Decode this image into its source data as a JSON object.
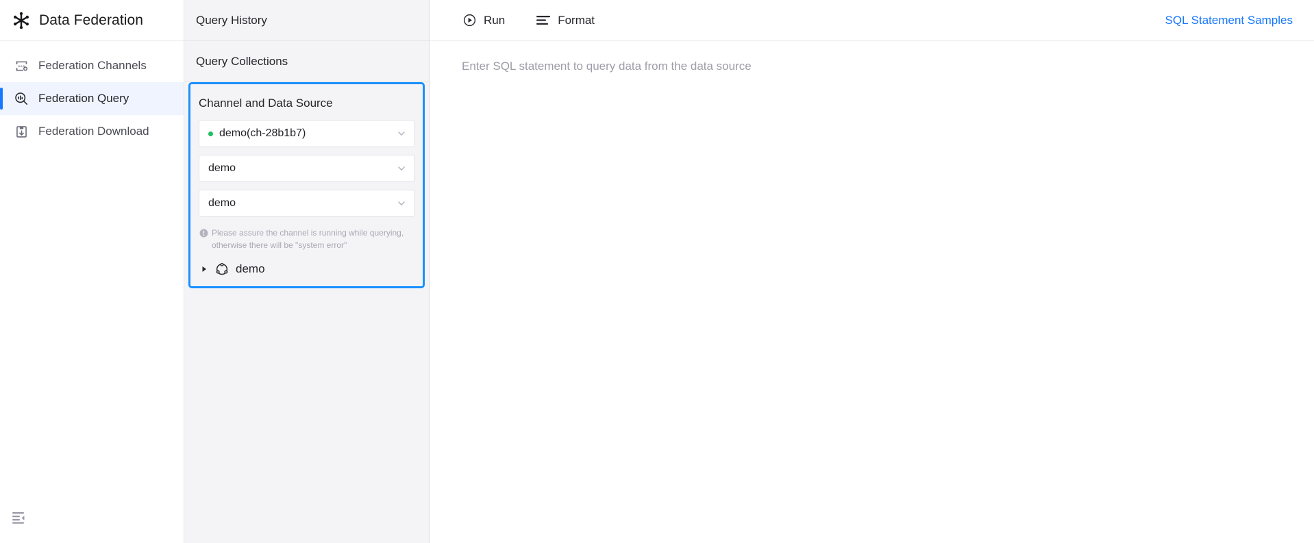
{
  "brand": {
    "title": "Data Federation",
    "logo_icon": "snowflake-logo-icon"
  },
  "sidebar": {
    "items": [
      {
        "label": "Federation Channels",
        "icon": "channels-icon",
        "active": false
      },
      {
        "label": "Federation Query",
        "icon": "query-search-icon",
        "active": true
      },
      {
        "label": "Federation Download",
        "icon": "download-box-icon",
        "active": false
      }
    ],
    "collapse_icon": "menu-fold-icon"
  },
  "midpanel": {
    "query_history_label": "Query History",
    "query_collections_label": "Query Collections",
    "datasource": {
      "title": "Channel and Data Source",
      "selects": [
        {
          "name": "channel-select",
          "value": "demo(ch-28b1b7)",
          "has_status_dot": true,
          "status_color": "#20c060"
        },
        {
          "name": "database-select",
          "value": "demo",
          "has_status_dot": false
        },
        {
          "name": "schema-select",
          "value": "demo",
          "has_status_dot": false
        }
      ],
      "hint_icon": "info-circle-icon",
      "hint_text": "Please assure the channel is running while querying, otherwise there will be \"system error\"",
      "tree": [
        {
          "label": "demo",
          "icon": "datasource-node-icon",
          "caret": "caret-right-icon",
          "expanded": false
        }
      ]
    }
  },
  "main": {
    "toolbar": {
      "run_label": "Run",
      "run_icon": "play-circle-icon",
      "format_label": "Format",
      "format_icon": "align-left-icon",
      "samples_label": "SQL Statement Samples"
    },
    "editor": {
      "placeholder": "Enter SQL statement to query data from the data source",
      "value": ""
    }
  },
  "colors": {
    "accent": "#1677ff",
    "highlight_border": "#1890ff",
    "active_nav_bg": "#eff4fe",
    "panel_bg": "#f4f4f7",
    "status_green": "#20c060",
    "muted_text": "#a9a9b4"
  }
}
